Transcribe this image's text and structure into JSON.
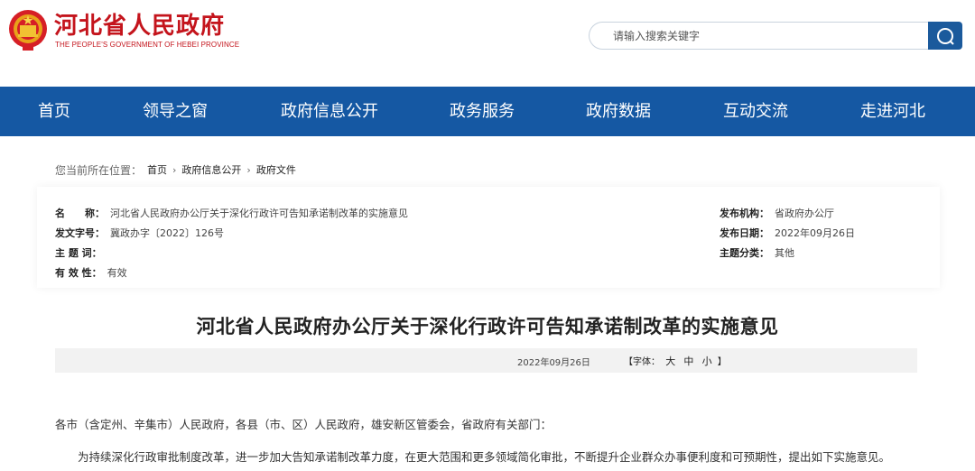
{
  "header": {
    "title": "河北省人民政府",
    "subtitle": "THE PEOPLE'S GOVERNMENT OF HEBEI PROVINCE",
    "search_placeholder": "请输入搜索关键字",
    "brand_color": "#c4141c"
  },
  "nav": {
    "color": "#1558a3",
    "items": [
      {
        "label": "首页"
      },
      {
        "label": "领导之窗"
      },
      {
        "label": "政府信息公开"
      },
      {
        "label": "政务服务"
      },
      {
        "label": "政府数据"
      },
      {
        "label": "互动交流"
      },
      {
        "label": "走进河北"
      }
    ]
  },
  "breadcrumb": {
    "prefix": "您当前所在位置：",
    "items": [
      "首页",
      "政府信息公开",
      "政府文件"
    ]
  },
  "info": {
    "name_label": "名　　称：",
    "name_value": "河北省人民政府办公厅关于深化行政许可告知承诺制改革的实施意见",
    "docno_label": "发文字号：",
    "docno_value": "冀政办字〔2022〕126号",
    "keywords_label": "主 题 词：",
    "keywords_value": "",
    "validity_label": "有 效 性：",
    "validity_value": "有效",
    "agency_label": "发布机构：",
    "agency_value": "省政府办公厅",
    "date_label": "发布日期：",
    "date_value": "2022年09月26日",
    "category_label": "主题分类：",
    "category_value": "其他"
  },
  "article": {
    "title": "河北省人民政府办公厅关于深化行政许可告知承诺制改革的实施意见",
    "date": "2022年09月26日",
    "fontsize_prefix": "【字体：",
    "fontsize_large": "大",
    "fontsize_medium": "中",
    "fontsize_small": "小",
    "fontsize_suffix": "】",
    "paragraphs": [
      "各市（含定州、辛集市）人民政府，各县（市、区）人民政府，雄安新区管委会，省政府有关部门：",
      "为持续深化行政审批制度改革，进一步加大告知承诺制改革力度，在更大范围和更多领域简化审批，不断提升企业群众办事便利度和可预期性，提出如下实施意见。"
    ]
  }
}
